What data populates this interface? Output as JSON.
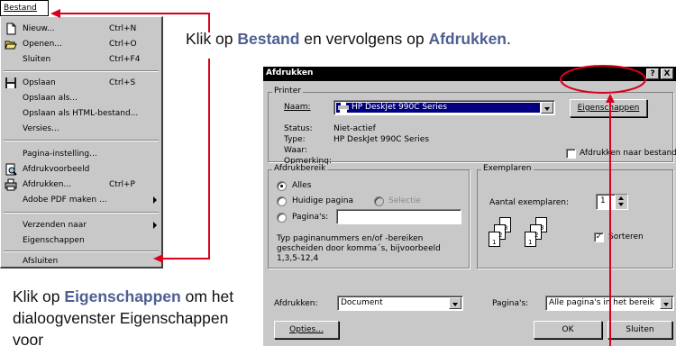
{
  "menu": {
    "menubar_label": "Bestand",
    "items": [
      {
        "label": "Nieuw...",
        "shortcut": "Ctrl+N",
        "icon": "new-document-icon"
      },
      {
        "label": "Openen...",
        "shortcut": "Ctrl+O",
        "icon": "open-folder-icon"
      },
      {
        "label": "Sluiten",
        "shortcut": "Ctrl+F4"
      },
      {
        "label": "Opslaan",
        "shortcut": "Ctrl+S",
        "icon": "floppy-disk-icon"
      },
      {
        "label": "Opslaan als..."
      },
      {
        "label": "Opslaan als HTML-bestand..."
      },
      {
        "label": "Versies..."
      },
      {
        "label": "Pagina-instelling..."
      },
      {
        "label": "Afdrukvoorbeeld",
        "icon": "print-preview-icon"
      },
      {
        "label": "Afdrukken...",
        "shortcut": "Ctrl+P",
        "icon": "printer-icon"
      },
      {
        "label": "Adobe PDF maken ...",
        "submenu": true
      },
      {
        "label": "Verzenden naar",
        "submenu": true
      },
      {
        "label": "Eigenschappen"
      },
      {
        "label": "Afsluiten"
      }
    ]
  },
  "captions": {
    "top_pre": "Klik op ",
    "top_hl1": "Bestand",
    "top_mid": " en vervolgens op ",
    "top_hl2": "Afdrukken",
    "top_post": ".",
    "bottom_pre": "Klik op ",
    "bottom_hl": "Eigenschappen",
    "bottom_rest": " om het dialoogvenster Eigenschappen voor"
  },
  "dialog": {
    "title": "Afdrukken",
    "help_button": "?",
    "close_button": "X",
    "printer": {
      "group_label": "Printer",
      "name_label": "Naam:",
      "name_value": "HP DeskJet 990C Series",
      "properties_button": "Eigenschappen",
      "status_label": "Status:",
      "status_value": "Niet-actief",
      "type_label": "Type:",
      "type_value": "HP DeskJet 990C Series",
      "where_label": "Waar:",
      "comment_label": "Opmerking:",
      "print_to_file_label": "Afdrukken naar bestand"
    },
    "range": {
      "group_label": "Afdrukbereik",
      "all_label": "Alles",
      "current_page_label": "Huidige pagina",
      "selection_label": "Selectie",
      "pages_label": "Pagina's:",
      "pages_value": "",
      "hint": "Typ paginanummers en/of -bereiken gescheiden door komma´s, bijvoorbeeld 1,3,5-12,4"
    },
    "copies": {
      "group_label": "Exemplaren",
      "count_label": "Aantal exemplaren:",
      "count_value": "1",
      "collate_label": "Sorteren"
    },
    "print_what_label": "Afdrukken:",
    "print_what_value": "Document",
    "pages_select_label": "Pagina's:",
    "pages_select_value": "Alle pagina's in het bereik",
    "options_button": "Opties...",
    "ok_button": "OK",
    "cancel_button": "Sluiten"
  },
  "colors": {
    "highlight_text": "#4e5f92",
    "annotation_red": "#d9001c"
  }
}
